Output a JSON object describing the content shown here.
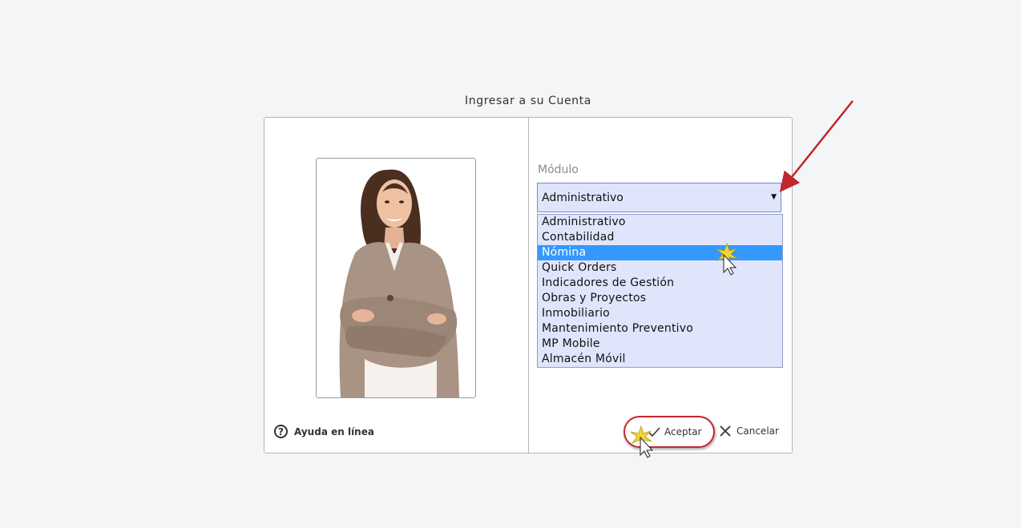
{
  "dialog": {
    "title": "Ingresar a su Cuenta",
    "help_label": "Ayuda en línea",
    "help_icon": "question-circle-icon",
    "module_label": "Módulo",
    "selected_value": "Administrativo",
    "options": [
      "Administrativo",
      "Contabilidad",
      "Nómina",
      "Quick Orders",
      "Indicadores de Gestión",
      "Obras y Proyectos",
      "Inmobiliario",
      "Mantenimiento Preventivo",
      "MP Mobile",
      "Almacén Móvil"
    ],
    "highlighted_option": "Nómina",
    "accept_label": "Aceptar",
    "cancel_label": "Cancelar"
  },
  "annotations": {
    "arrow_color": "#c1272d",
    "ring_color": "#c1272d",
    "highlight_color": "#3399ff"
  }
}
